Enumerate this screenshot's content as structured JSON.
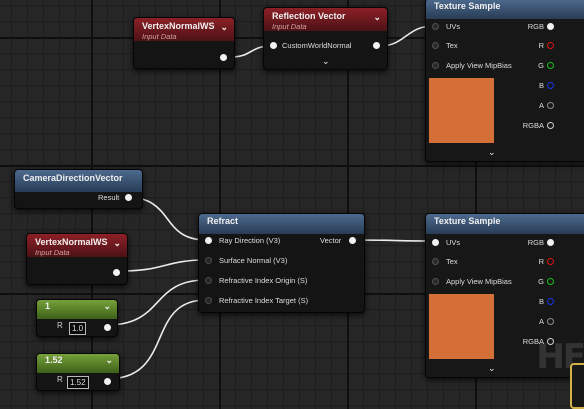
{
  "nodes": {
    "vertex_top": {
      "title": "VertexNormalWS",
      "subtitle": "Input Data"
    },
    "reflection": {
      "title": "Reflection Vector",
      "subtitle": "Input Data",
      "input": "CustomWorldNormal"
    },
    "tex_top": {
      "title": "Texture Sample",
      "inputs": [
        "UVs",
        "Tex",
        "Apply View MipBias"
      ],
      "outputs": [
        "RGB",
        "R",
        "G",
        "B",
        "A",
        "RGBA"
      ],
      "preview_color": "#d46f38"
    },
    "camera": {
      "title": "CameraDirectionVector",
      "output": "Result"
    },
    "vertex_mid": {
      "title": "VertexNormalWS",
      "subtitle": "Input Data"
    },
    "refract": {
      "title": "Refract",
      "inputs": [
        "Ray Direction (V3)",
        "Surface Normal (V3)",
        "Refractive Index Origin (S)",
        "Refractive Index Target (S)"
      ],
      "output": "Vector"
    },
    "tex_bottom": {
      "title": "Texture Sample",
      "inputs": [
        "UVs",
        "Tex",
        "Apply View MipBias"
      ],
      "outputs": [
        "RGB",
        "R",
        "G",
        "B",
        "A",
        "RGBA"
      ],
      "preview_color": "#d46f38"
    },
    "const1": {
      "title": "1",
      "value_label": "1.0",
      "pin_label": "R"
    },
    "const2": {
      "title": "1.52",
      "value_label": "1.52",
      "pin_label": "R"
    }
  },
  "icons": {
    "collapse": "chevron-down-icon",
    "expand": "chevron-down-icon"
  },
  "watermark": "HF",
  "colors": {
    "input_header": "#8c2026",
    "function_header": "#4c6a8e",
    "constant_header": "#75a13a",
    "preview": "#d46f38",
    "background": "#262626"
  }
}
